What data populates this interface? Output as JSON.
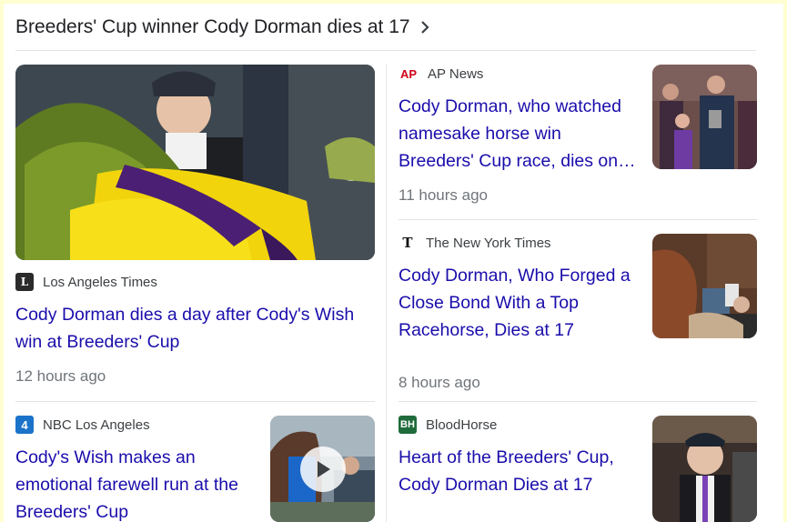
{
  "header": {
    "title": "Breeders' Cup winner Cody Dorman dies at 17"
  },
  "articles": [
    {
      "source": "Los Angeles Times",
      "logo": "L",
      "headline": "Cody Dorman dies a day after Cody's Wish win at Breeders' Cup",
      "time": "12 hours ago"
    },
    {
      "source": "AP News",
      "logo": "AP",
      "headline": "Cody Dorman, who watched namesake horse win Breeders' Cup race, dies on…",
      "time": "11 hours ago"
    },
    {
      "source": "The New York Times",
      "logo": "T",
      "headline": "Cody Dorman, Who Forged a Close Bond With a Top Racehorse, Dies at 17",
      "time": "8 hours ago"
    },
    {
      "source": "NBC Los Angeles",
      "logo": "4",
      "headline": "Cody's Wish makes an emotional farewell run at the Breeders' Cup"
    },
    {
      "source": "BloodHorse",
      "logo": "BH",
      "headline": "Heart of the Breeders' Cup, Cody Dorman Dies at 17"
    }
  ],
  "colors": {
    "link": "#1a0dab",
    "meta": "#70757a",
    "page_border": "#fefed0"
  }
}
